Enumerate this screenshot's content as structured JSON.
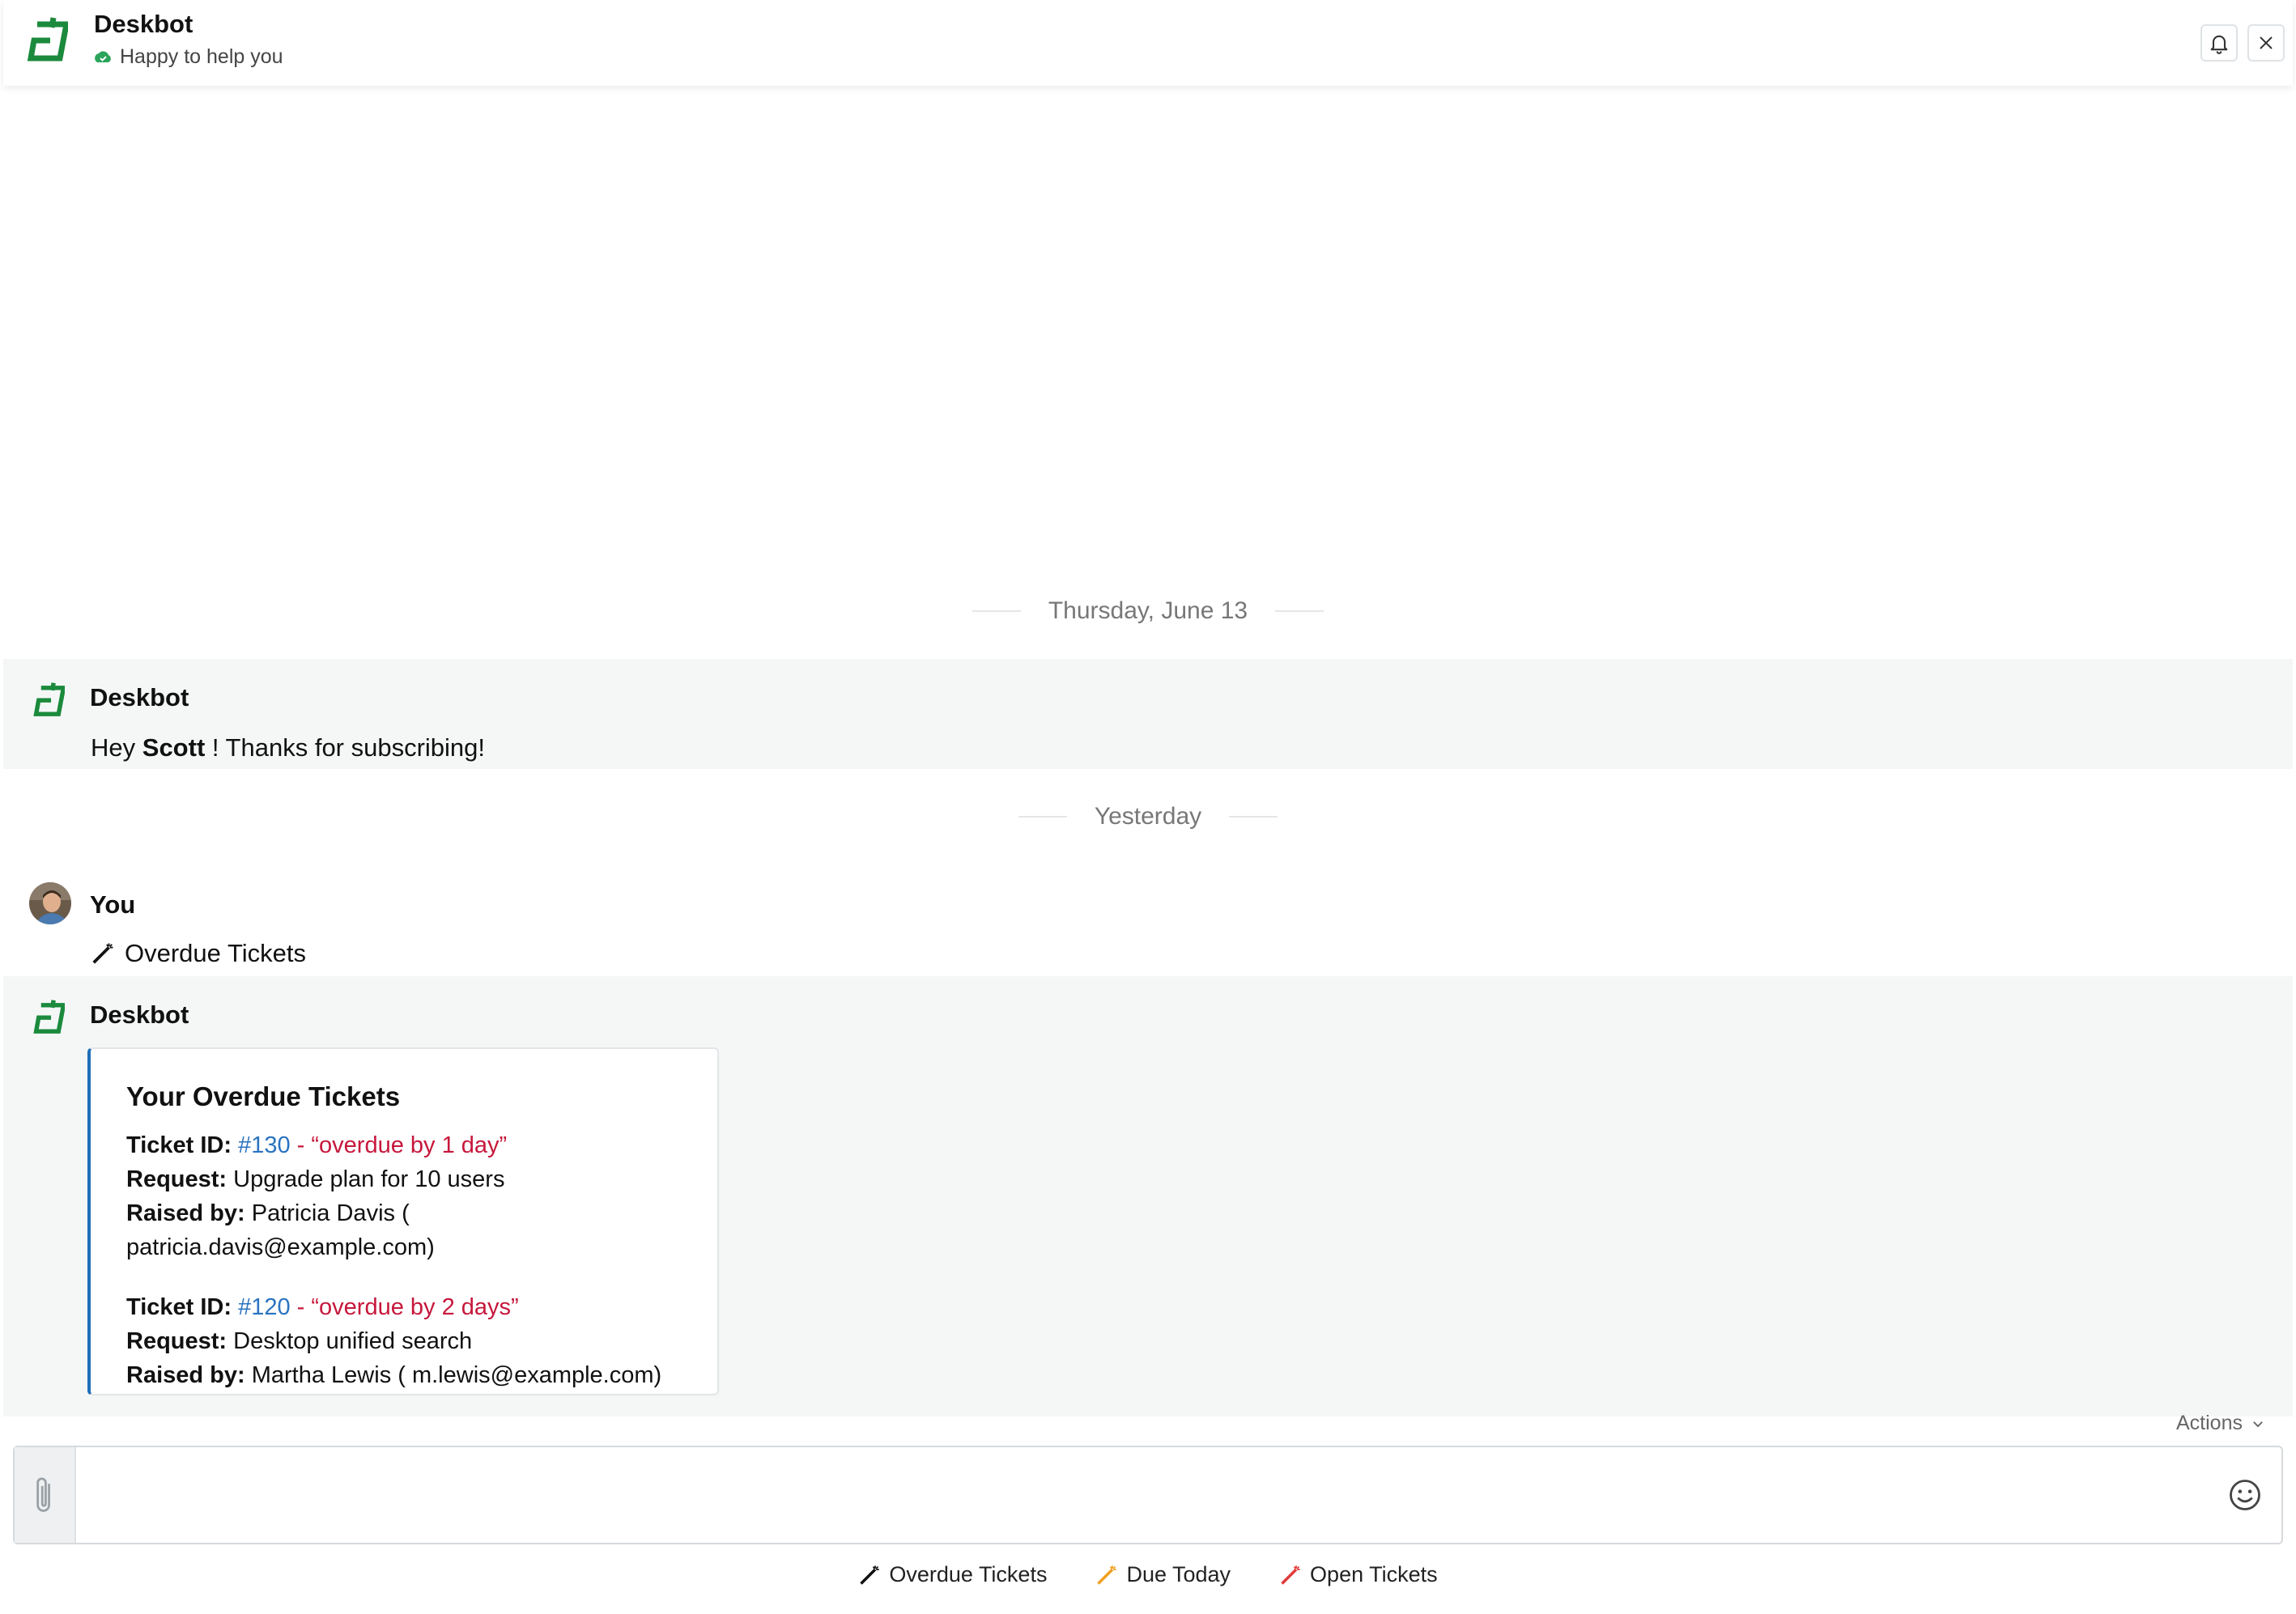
{
  "header": {
    "title": "Deskbot",
    "status": "Happy to help you",
    "brand_color": "#1b8a3c"
  },
  "separators": {
    "first": "Thursday, June 13",
    "second": "Yesterday"
  },
  "messages": {
    "welcome": {
      "sender": "Deskbot",
      "prefix": "Hey",
      "name": "Scott",
      "suffix": "! Thanks for subscribing!"
    },
    "user": {
      "sender": "You",
      "text": "Overdue Tickets"
    },
    "overdue": {
      "sender": "Deskbot",
      "card_title": "Your Overdue Tickets",
      "tickets": [
        {
          "id_label": "Ticket ID:",
          "id": "#130",
          "dash": " - ",
          "overdue": "“overdue by 1 day”",
          "request_label": "Request:",
          "request": "Upgrade plan for 10 users",
          "raised_label": "Raised by:",
          "raised": "Patricia Davis ( patricia.davis@example.com)"
        },
        {
          "id_label": "Ticket ID:",
          "id": "#120",
          "dash": " - ",
          "overdue": "“overdue by 2 days”",
          "request_label": "Request:",
          "request": "Desktop unified search",
          "raised_label": "Raised by:",
          "raised": "Martha Lewis ( m.lewis@example.com)"
        }
      ]
    }
  },
  "composer": {
    "actions_label": "Actions",
    "placeholder": ""
  },
  "quick_actions": [
    {
      "label": "Overdue Tickets",
      "icon": "magic-wand-icon",
      "color": "#111111"
    },
    {
      "label": "Due Today",
      "icon": "magic-wand-icon",
      "color": "#f0a020"
    },
    {
      "label": "Open Tickets",
      "icon": "magic-wand-icon",
      "color": "#e23a3a"
    }
  ]
}
